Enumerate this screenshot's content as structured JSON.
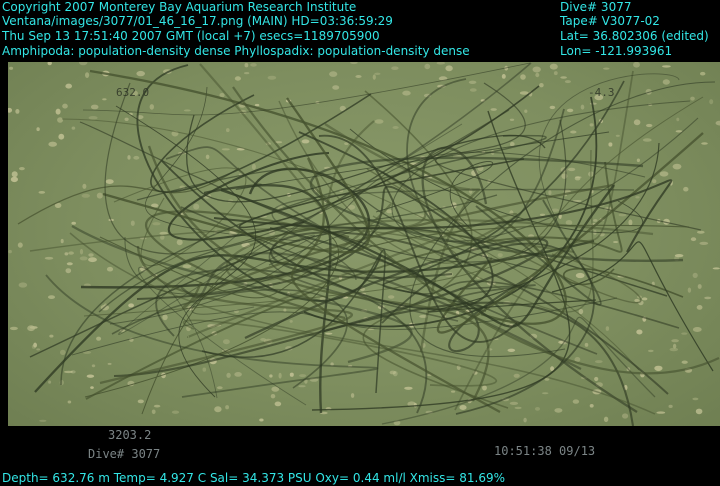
{
  "overlay": {
    "copyright": "Copyright 2007 Monterey Bay Aquarium Research Institute",
    "image_path": "Ventana/images/3077/01_46_16_17.png (MAIN)  HD=03:36:59:29",
    "datetime": "Thu Sep 13 17:51:40 2007 GMT (local +7)  esecs=1189705900",
    "annotation": "Amphipoda: population-density dense Phyllospadix: population-density dense",
    "dive": "Dive# 3077",
    "tape": "Tape# V3077-02",
    "lat": "Lat= 36.802306 (edited)",
    "lon": "Lon= -121.993961",
    "sensors": "Depth= 632.76 m  Temp= 4.927 C  Sal= 34.373 PSU  Oxy= 0.44 ml/l  Xmiss= 81.69%"
  },
  "burn_in": {
    "depth_value": "3203.2",
    "dive_label": "Dive# 3077",
    "timestamp": "10:51:38 09/13"
  },
  "colors": {
    "overlay_text": "#33e6e6",
    "water": "#7e8e5f"
  }
}
